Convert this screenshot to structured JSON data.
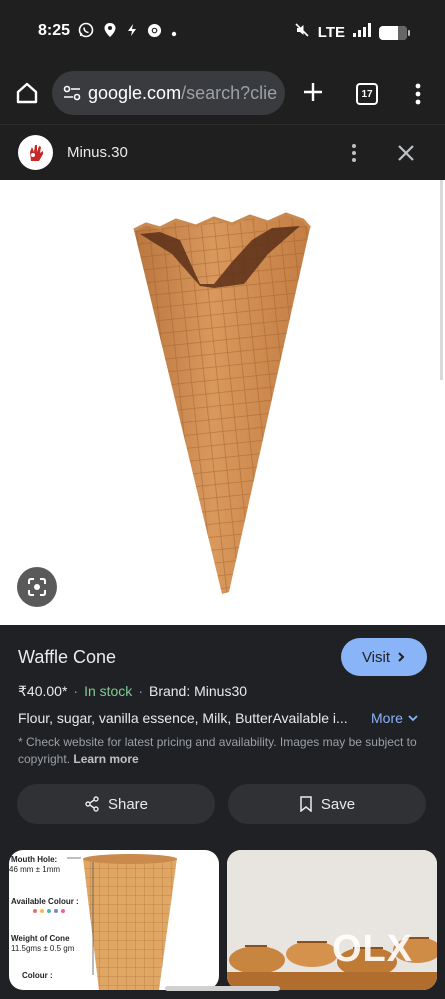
{
  "status": {
    "time": "8:25",
    "network": "LTE"
  },
  "toolbar": {
    "url_host": "google.com",
    "url_path": "/search?clie",
    "tab_count": "17"
  },
  "lens": {
    "site_name": "Minus.30"
  },
  "product": {
    "title": "Waffle Cone",
    "visit_label": "Visit",
    "price": "₹40.00*",
    "stock": "In stock",
    "brand": "Brand: Minus30",
    "description": "Flour, sugar, vanilla essence, Milk, ButterAvailable i...",
    "more_label": "More",
    "note": "* Check website for latest pricing and availability. Images may be subject to copyright.",
    "learn_more": "Learn more",
    "share_label": "Share",
    "save_label": "Save"
  },
  "related": {
    "card1": {
      "mouth_hole_label": "Mouth Hole:",
      "mouth_hole_value": "46 mm ± 1mm",
      "colour_label": "Available Colour :",
      "weight_label": "Weight of Cone",
      "weight_value": "11.5gms ± 0.5 gm",
      "colour_label_2": "Colour :"
    },
    "card2": {
      "watermark": "OLX"
    }
  },
  "colors": {
    "accent": "#8ab4f8",
    "stock": "#81c995",
    "background": "#202124"
  }
}
